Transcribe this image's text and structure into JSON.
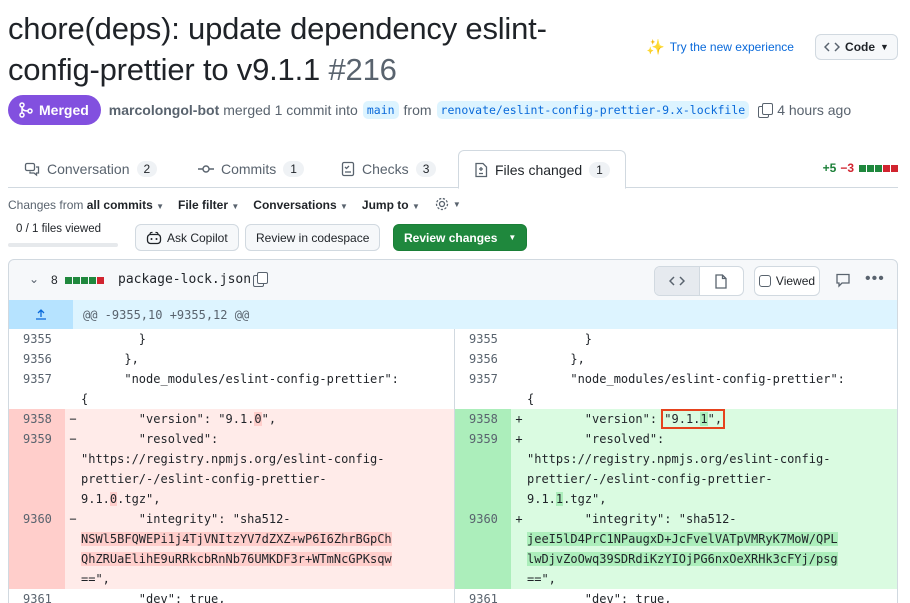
{
  "header": {
    "title": "chore(deps): update dependency eslint-config-prettier to v9.1.1",
    "number": "#216",
    "try_experience": "Try the new experience",
    "code_button": "Code"
  },
  "meta": {
    "status": "Merged",
    "author": "marcolongol-bot",
    "action": "merged 1 commit into",
    "base_branch": "main",
    "from": "from",
    "head_branch": "renovate/eslint-config-prettier-9.x-lockfile",
    "time": "4 hours ago"
  },
  "tabs": [
    {
      "label": "Conversation",
      "count": "2"
    },
    {
      "label": "Commits",
      "count": "1"
    },
    {
      "label": "Checks",
      "count": "3"
    },
    {
      "label": "Files changed",
      "count": "1"
    }
  ],
  "diffstat": {
    "additions": "+5",
    "deletions": "−3"
  },
  "toolbar": {
    "changes_prefix": "Changes from",
    "changes_value": "all commits",
    "file_filter": "File filter",
    "conversations": "Conversations",
    "jump_to": "Jump to",
    "files_viewed": "0 / 1 files viewed",
    "ask_copilot": "Ask Copilot",
    "review_codespace": "Review in codespace",
    "review_changes": "Review changes"
  },
  "file": {
    "changes": "8",
    "name": "package-lock.json",
    "viewed": "Viewed"
  },
  "hunk": "@@ -9355,10 +9355,12 @@",
  "colors": {
    "merged": "#8250df",
    "primary": "#1f883d",
    "link": "#0969da",
    "add_bg": "#dafbe1",
    "del_bg": "#ffebe9"
  },
  "diff": {
    "left": [
      {
        "ln": "9355",
        "mk": "",
        "type": "ctx",
        "pre": "        }"
      },
      {
        "ln": "9356",
        "mk": "",
        "type": "ctx",
        "pre": "      },"
      },
      {
        "ln": "9357",
        "mk": "",
        "type": "ctx",
        "pre": "      \"node_modules/eslint-config-prettier\":\n{"
      },
      {
        "ln": "9358",
        "mk": "−",
        "type": "del",
        "pre": "        \"version\": \"9.1.",
        "hl": "0",
        "post": "\","
      },
      {
        "ln": "9359",
        "mk": "−",
        "type": "del",
        "pre": "        \"resolved\":\n\"https://registry.npmjs.org/eslint-config-\nprettier/-/eslint-config-prettier-\n9.1.",
        "hl": "0",
        "post": ".tgz\","
      },
      {
        "ln": "9360",
        "mk": "−",
        "type": "del",
        "pre": "        \"integrity\": \"sha512-\n",
        "hl": "NSWl5BFQWEPi1j4TjVNItzYV7dZXZ+wP6I6ZhrBGpCh\nQhZRUaElihE9uRRkcbRnNb76UMKDF3r+WTmNcGPKsqw",
        "post": "\n==\","
      },
      {
        "ln": "9361",
        "mk": "",
        "type": "ctx",
        "pre": "        \"dev\": true,"
      }
    ],
    "right": [
      {
        "ln": "9355",
        "mk": "",
        "type": "ctx",
        "pre": "        }"
      },
      {
        "ln": "9356",
        "mk": "",
        "type": "ctx",
        "pre": "      },"
      },
      {
        "ln": "9357",
        "mk": "",
        "type": "ctx",
        "pre": "      \"node_modules/eslint-config-prettier\":\n{"
      },
      {
        "ln": "9358",
        "mk": "+",
        "type": "add",
        "pre": "        \"version\": ",
        "boxed": "\"9.1.1\",",
        "post": ""
      },
      {
        "ln": "9359",
        "mk": "+",
        "type": "add",
        "pre": "        \"resolved\":\n\"https://registry.npmjs.org/eslint-config-\nprettier/-/eslint-config-prettier-\n9.1.",
        "hl": "1",
        "post": ".tgz\","
      },
      {
        "ln": "9360",
        "mk": "+",
        "type": "add",
        "pre": "        \"integrity\": \"sha512-\n",
        "hl": "jeeI5lD4PrC1NPaugxD+JcFvelVATpVMRyK7MoW/QPL\nlwDjvZoOwq39SDRdiKzYIOjPG6nxOeXRHk3cFYj/psg",
        "post": "\n==\","
      },
      {
        "ln": "9361",
        "mk": "",
        "type": "ctx",
        "pre": "        \"dev\": true,"
      }
    ]
  }
}
